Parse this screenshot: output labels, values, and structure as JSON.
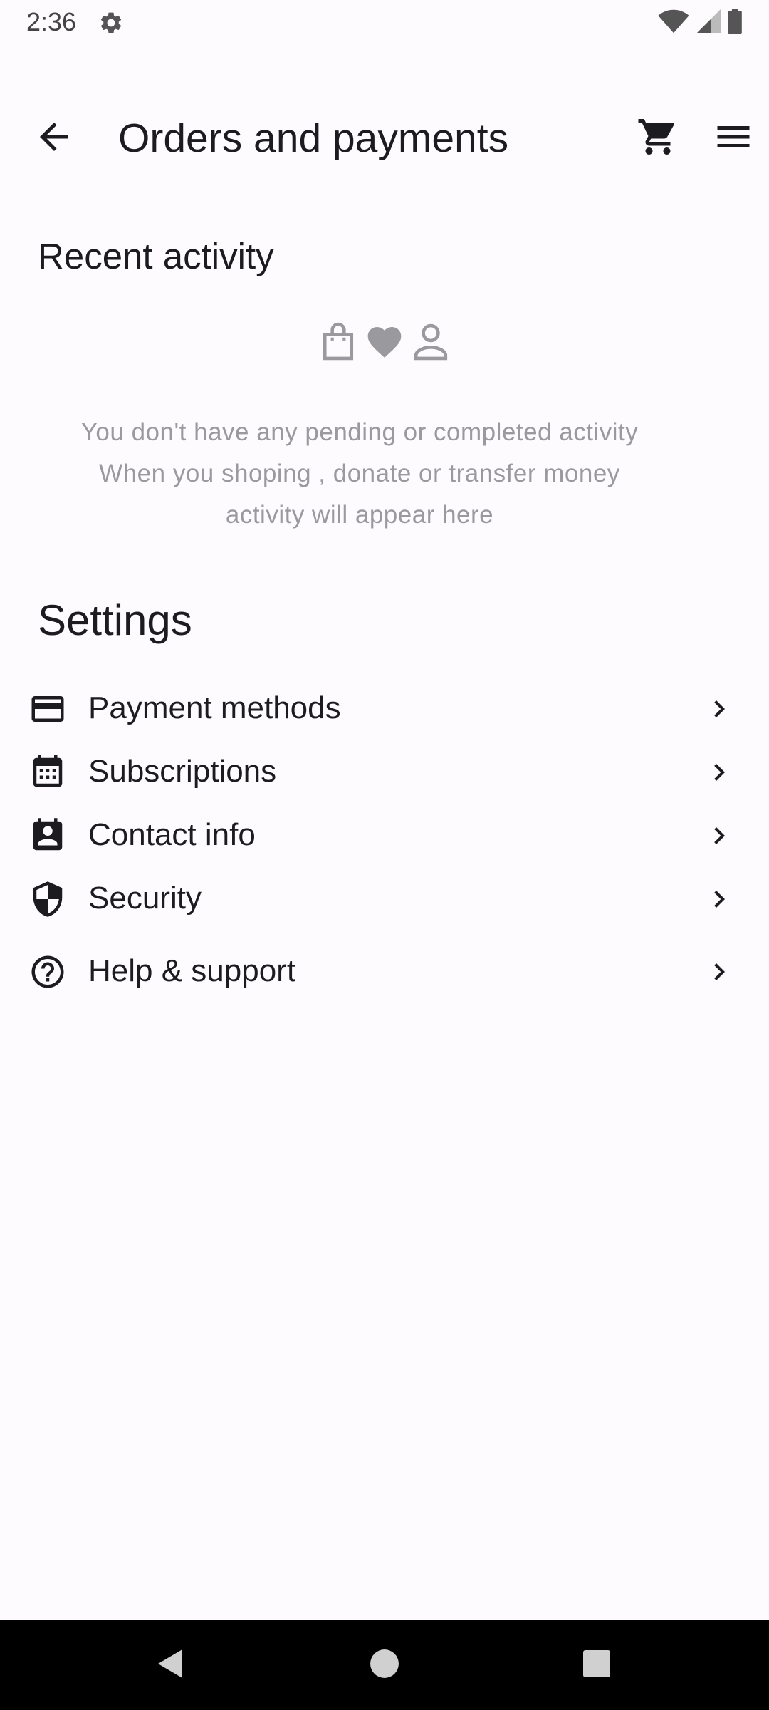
{
  "status_bar": {
    "time": "2:36",
    "icons": [
      "settings-icon",
      "wifi-icon",
      "signal-icon",
      "battery-icon"
    ]
  },
  "app_bar": {
    "title": "Orders and payments",
    "icons": [
      "arrow-back-icon",
      "shopping-cart-icon",
      "menu-icon"
    ]
  },
  "recent_activity": {
    "title": "Recent activity",
    "icons": [
      "shopping-bag-icon",
      "heart-icon",
      "person-icon"
    ],
    "empty_lines": [
      "You don't have any pending or completed activity",
      "When you shoping , donate or transfer money",
      "activity will appear here"
    ]
  },
  "settings": {
    "title": "Settings",
    "items": [
      {
        "label": "Payment methods",
        "icon": "credit-card-icon"
      },
      {
        "label": "Subscriptions",
        "icon": "calendar-icon"
      },
      {
        "label": "Contact info",
        "icon": "contact-card-icon"
      },
      {
        "label": "Security",
        "icon": "shield-icon"
      },
      {
        "label": "Help & support",
        "icon": "help-circle-icon"
      }
    ]
  },
  "nav_bar": {
    "icons": [
      "nav-back-icon",
      "nav-home-icon",
      "nav-recents-icon"
    ]
  },
  "colors": {
    "background": "#fefbff",
    "text": "#1c1b1f",
    "muted_text": "#9a999e",
    "nav_bar": "#000000"
  }
}
